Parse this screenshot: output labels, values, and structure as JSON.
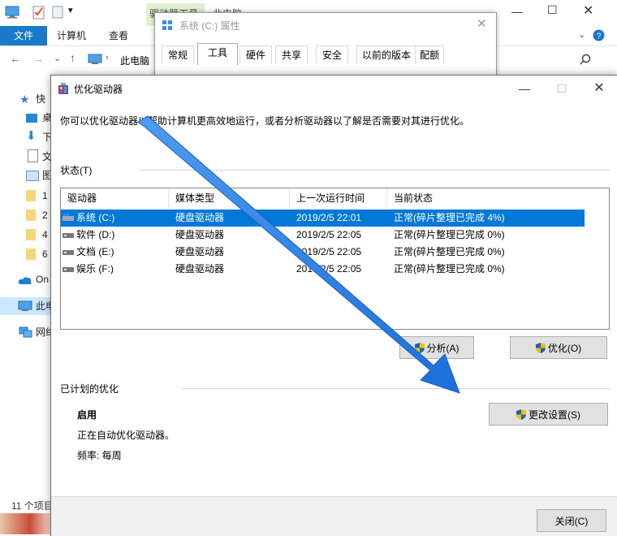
{
  "explorer": {
    "file_tab": "文件",
    "tabs": [
      "计算机",
      "查看"
    ],
    "context_tab": "驱动器工具",
    "context_title": "此电脑",
    "address": "此电脑",
    "nav_items": [
      "快",
      "桌",
      "下",
      "文",
      "图",
      "1",
      "2",
      "4",
      "6",
      "On",
      "此电",
      "网络"
    ],
    "status_text": "11 个项目"
  },
  "properties_dialog": {
    "title": "系统 (C:) 属性",
    "tabs": [
      "常规",
      "工具",
      "硬件",
      "共享",
      "安全",
      "以前的版本",
      "配额"
    ]
  },
  "optimize_dialog": {
    "title": "优化驱动器",
    "description": "你可以优化驱动器以帮助计算机更高效地运行，或者分析驱动器以了解是否需要对其进行优化。",
    "status_label": "状态(T)",
    "columns": [
      "驱动器",
      "媒体类型",
      "上一次运行时间",
      "当前状态"
    ],
    "drives": [
      {
        "name": "系统 (C:)",
        "media": "硬盘驱动器",
        "last_run": "2019/2/5 22:01",
        "status": "正常(碎片整理已完成 4%)"
      },
      {
        "name": "软件 (D:)",
        "media": "硬盘驱动器",
        "last_run": "2019/2/5 22:05",
        "status": "正常(碎片整理已完成 0%)"
      },
      {
        "name": "文档 (E:)",
        "media": "硬盘驱动器",
        "last_run": "2019/2/5 22:05",
        "status": "正常(碎片整理已完成 0%)"
      },
      {
        "name": "娱乐 (F:)",
        "media": "硬盘驱动器",
        "last_run": "2019/2/5 22:05",
        "status": "正常(碎片整理已完成 0%)"
      }
    ],
    "analyze_button": "分析(A)",
    "optimize_button": "优化(O)",
    "scheduled_label": "已计划的优化",
    "schedule_state": "启用",
    "schedule_desc": "正在自动优化驱动器。",
    "frequency": "频率: 每周",
    "change_settings_button": "更改设置(S)",
    "close_button": "关闭(C)"
  },
  "colors": {
    "selection": "#0078d7",
    "file_tab": "#1979ca",
    "arrow": "#2f7fe0",
    "shield_blue": "#1f5fbf",
    "shield_yellow": "#f2c200"
  }
}
